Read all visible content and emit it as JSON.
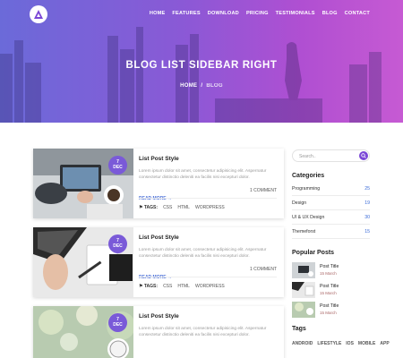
{
  "nav": {
    "items": [
      "HOME",
      "FEATURES",
      "DOWNLOAD",
      "PRICING",
      "TESTIMONIALS",
      "BLOG",
      "CONTACT"
    ],
    "logo_icon": "logo-triangle-icon"
  },
  "hero": {
    "title": "BLOG LIST SIDEBAR RIGHT",
    "breadcrumb": {
      "home": "HOME",
      "separator": "/",
      "current": "BLOG"
    }
  },
  "posts": [
    {
      "title": "List Post Style",
      "day": "7",
      "month": "DEC",
      "excerpt": "Lorem ipsum dolor sit amet, consectetur adipisicing elit. Aspernatur consectetur distinctio deleniti ea facilis nisi excepturi dolor.",
      "read_more": "READ MORE →",
      "comments": "1 COMMENT",
      "tags_label": "TAGS:",
      "tags": [
        "CSS",
        "HTML",
        "WORDPRESS"
      ]
    },
    {
      "title": "List Post Style",
      "day": "7",
      "month": "DEC",
      "excerpt": "Lorem ipsum dolor sit amet, consectetur adipisicing elit. Aspernatur consectetur distinctio deleniti ea facilis nisi excepturi dolor.",
      "read_more": "READ MORE →",
      "comments": "1 COMMENT",
      "tags_label": "TAGS:",
      "tags": [
        "CSS",
        "HTML",
        "WORDPRESS"
      ]
    },
    {
      "title": "List Post Style",
      "day": "7",
      "month": "DEC",
      "excerpt": "Lorem ipsum dolor sit amet, consectetur adipisicing elit. Aspernatur consectetur distinctio deleniti ea facilis nisi excepturi dolor."
    }
  ],
  "sidebar": {
    "search_placeholder": "Search..",
    "categories_heading": "Categories",
    "categories": [
      {
        "name": "Programming",
        "count": "25"
      },
      {
        "name": "Design",
        "count": "19"
      },
      {
        "name": "UI & UX Design",
        "count": "30"
      },
      {
        "name": "Themeforst",
        "count": "15"
      }
    ],
    "popular_heading": "Popular Posts",
    "popular": [
      {
        "title": "Post Title",
        "date": "15 March"
      },
      {
        "title": "Post Title",
        "date": "15 March"
      },
      {
        "title": "Post Title",
        "date": "15 March"
      }
    ],
    "tags_heading": "Tags",
    "tags": [
      "ANDROID",
      "LIFESTYLE",
      "IOS",
      "MOBILE",
      "APP"
    ]
  },
  "colors": {
    "accent": "#7a46d6",
    "hero_gradient_start": "#6b6ad9",
    "hero_gradient_end": "#c65ad3",
    "link": "#4a6fd8"
  }
}
